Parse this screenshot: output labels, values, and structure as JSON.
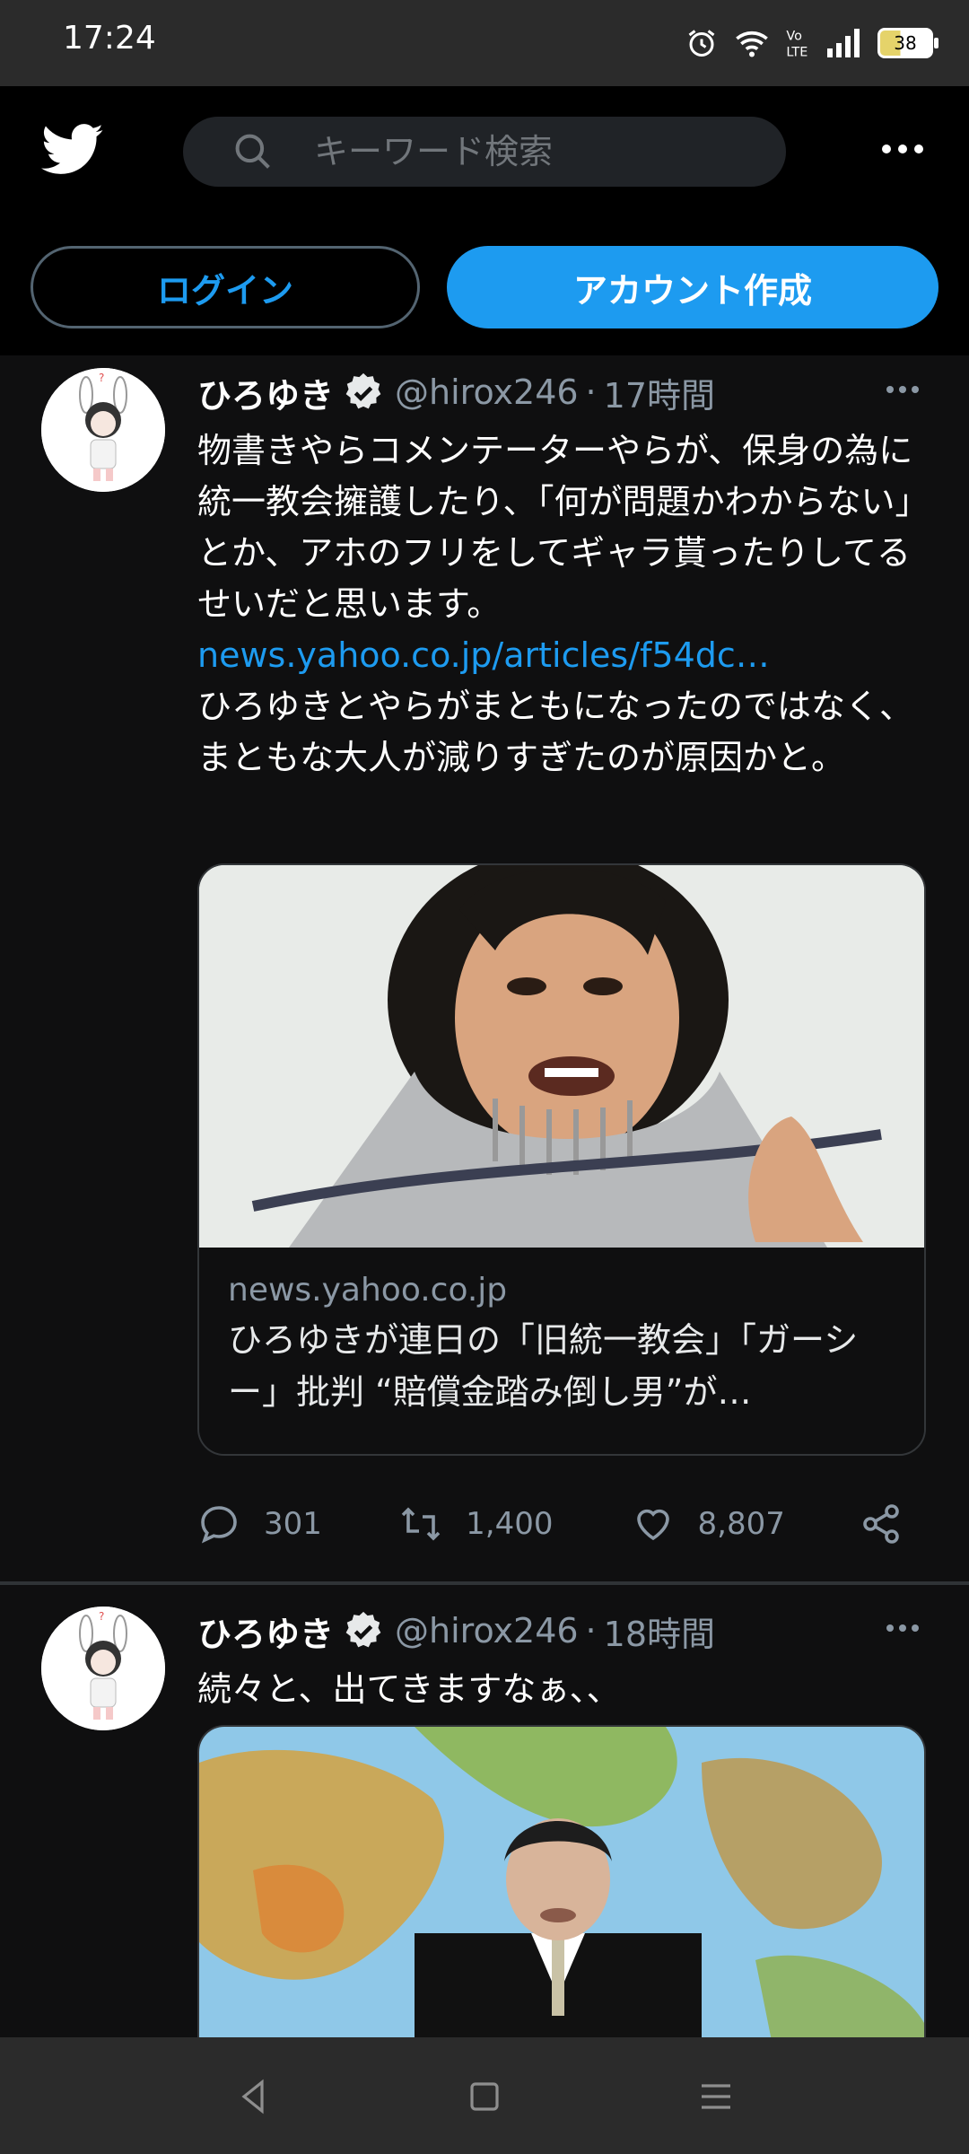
{
  "status_bar": {
    "time": "17:24",
    "battery": "38",
    "icons": [
      "alarm-icon",
      "wifi-icon",
      "volte-icon",
      "signal-icon",
      "battery-icon"
    ]
  },
  "header": {
    "logo": "twitter-bird-icon",
    "search_placeholder": "キーワード検索",
    "more": "more-icon"
  },
  "auth": {
    "login_label": "ログイン",
    "signup_label": "アカウント作成"
  },
  "colors": {
    "accent": "#1d9bf0",
    "background": "#000000",
    "text_secondary": "#8b98a5"
  },
  "tweets": [
    {
      "name": "ひろゆき",
      "handle": "@hirox246",
      "time": "17時間",
      "text_1": "物書きやらコメンテーターやらが、保身の為に統一教会擁護したり、「何が問題かわからない」とか、アホのフリをしてギャラ貰ったりしてるせいだと思います。",
      "link": "news.yahoo.co.jp/articles/f54dc…",
      "text_2": "ひろゆきとやらがまともになったのではなく、まともな大人が減りすぎたのが原因かと。",
      "card": {
        "domain": "news.yahoo.co.jp",
        "title": "ひろゆきが連日の「旧統一教会」「ガーシー」批判 “賠償金踏み倒し男”が…"
      },
      "replies": "301",
      "retweets": "1,400",
      "likes": "8,807"
    },
    {
      "name": "ひろゆき",
      "handle": "@hirox246",
      "time": "18時間",
      "text_1": "続々と、出てきますなぁ、、"
    }
  ],
  "navbar": {
    "back": "back-icon",
    "home": "home-icon",
    "menu": "menu-icon"
  }
}
